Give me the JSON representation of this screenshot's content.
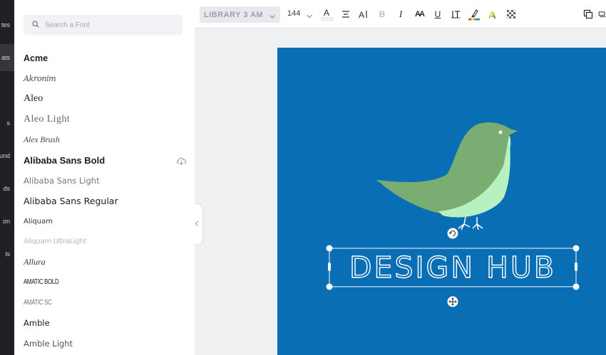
{
  "rail": {
    "items": [
      {
        "label": "tes",
        "active": false
      },
      {
        "label": "ats",
        "active": true
      },
      {
        "label": "s",
        "active": false
      },
      {
        "label": "und",
        "active": false
      },
      {
        "label": "ds",
        "active": false
      },
      {
        "label": "on",
        "active": false
      },
      {
        "label": "ls",
        "active": false
      }
    ]
  },
  "font_panel": {
    "search_placeholder": "Search a Font",
    "fonts": [
      {
        "name": "Acme",
        "downloadable": false
      },
      {
        "name": "Akronim",
        "downloadable": false
      },
      {
        "name": "Aleo",
        "downloadable": false
      },
      {
        "name": "Aleo Light",
        "downloadable": false
      },
      {
        "name": "Alex Brush",
        "downloadable": false
      },
      {
        "name": "Alibaba Sans Bold",
        "downloadable": true
      },
      {
        "name": "Alibaba Sans Light",
        "downloadable": false
      },
      {
        "name": "Alibaba Sans Regular",
        "downloadable": false
      },
      {
        "name": "Aliquam",
        "downloadable": false
      },
      {
        "name": "Aliquam UltraLight",
        "downloadable": false
      },
      {
        "name": "Allura",
        "downloadable": false
      },
      {
        "name": "Amatic Bold",
        "downloadable": false
      },
      {
        "name": "Amatic SC",
        "downloadable": false
      },
      {
        "name": "Amble",
        "downloadable": false
      },
      {
        "name": "Amble Light",
        "downloadable": false
      }
    ]
  },
  "toolbar": {
    "font_family": "LIBRARY 3 AM",
    "font_size": "144",
    "buttons": [
      {
        "name": "text-color-button",
        "glyph": "A"
      },
      {
        "name": "align-button",
        "glyph": "≡"
      },
      {
        "name": "text-size-button",
        "glyph": "AI"
      },
      {
        "name": "bold-button",
        "glyph": "B"
      },
      {
        "name": "italic-button",
        "glyph": "I"
      },
      {
        "name": "letter-case-button",
        "glyph": "AA"
      },
      {
        "name": "underline-button",
        "glyph": "U"
      },
      {
        "name": "line-spacing-button",
        "glyph": "IT"
      },
      {
        "name": "highlight-button",
        "glyph": "✎"
      },
      {
        "name": "text-effects-button",
        "glyph": "A"
      },
      {
        "name": "transparency-button",
        "glyph": "▦"
      },
      {
        "name": "duplicate-button",
        "glyph": "⧉"
      }
    ]
  },
  "canvas": {
    "background": "#0a6eb4",
    "headline": "DESIGN HUB",
    "bird_body_color": "#7aad71",
    "bird_belly_color": "#b6f1bf"
  }
}
